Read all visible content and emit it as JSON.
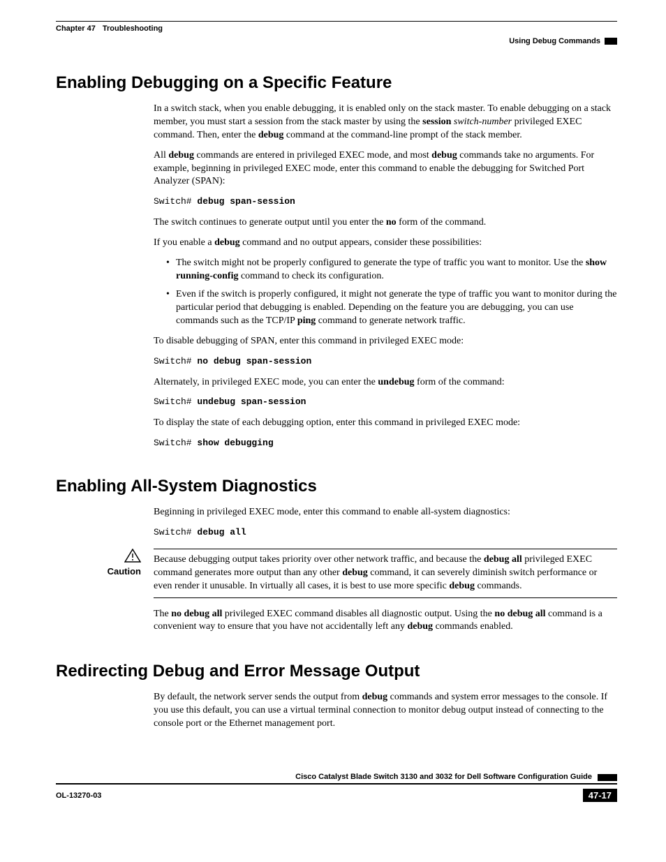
{
  "header": {
    "chapter": "Chapter 47",
    "chapter_title": "Troubleshooting",
    "section_label": "Using Debug Commands"
  },
  "s1": {
    "title": "Enabling Debugging on a Specific Feature",
    "p1a": "In a switch stack, when you enable debugging, it is enabled only on the stack master. To enable debugging on a stack member, you must start a session from the stack master by using the ",
    "p1b_bold": "session",
    "p1c_it": " switch-number",
    "p1d": " privileged EXEC command. Then, enter the ",
    "p1e_bold": "debug",
    "p1f": " command at the command-line prompt of the stack member.",
    "p2a": "All ",
    "p2b_bold": "debug",
    "p2c": " commands are entered in privileged EXEC mode, and most ",
    "p2d_bold": "debug",
    "p2e": " commands take no arguments. For example, beginning in privileged EXEC mode, enter this command to enable the debugging for Switched Port Analyzer (SPAN):",
    "code1_prompt": "Switch# ",
    "code1_cmd": "debug span-session",
    "p3a": "The switch continues to generate output until you enter the ",
    "p3b_bold": "no",
    "p3c": " form of the command.",
    "p4a": "If you enable a ",
    "p4b_bold": "debug",
    "p4c": " command and no output appears, consider these possibilities:",
    "li1a": "The switch might not be properly configured to generate the type of traffic you want to monitor. Use the ",
    "li1b_bold": "show running-config",
    "li1c": " command to check its configuration.",
    "li2a": "Even if the switch is properly configured, it might not generate the type of traffic you want to monitor during the particular period that debugging is enabled. Depending on the feature you are debugging, you can use commands such as the TCP/IP ",
    "li2b_bold": "ping",
    "li2c": " command to generate network traffic.",
    "p5": "To disable debugging of SPAN, enter this command in privileged EXEC mode:",
    "code2_prompt": "Switch# ",
    "code2_cmd": "no debug span-session",
    "p6a": "Alternately, in privileged EXEC mode, you can enter the ",
    "p6b_bold": "undebug",
    "p6c": " form of the command:",
    "code3_prompt": "Switch# ",
    "code3_cmd": "undebug span-session",
    "p7": "To display the state of each debugging option, enter this command in privileged EXEC mode:",
    "code4_prompt": "Switch# ",
    "code4_cmd": "show debugging"
  },
  "s2": {
    "title": "Enabling All-System Diagnostics",
    "p1": "Beginning in privileged EXEC mode, enter this command to enable all-system diagnostics:",
    "code1_prompt": "Switch# ",
    "code1_cmd": "debug all",
    "caution_label": "Caution",
    "c1a": "Because debugging output takes priority over other network traffic, and because the ",
    "c1b_bold": "debug all",
    "c1c": " privileged EXEC command generates more output than any other ",
    "c1d_bold": "debug",
    "c1e": " command, it can severely diminish switch performance or even render it unusable. In virtually all cases, it is best to use more specific ",
    "c1f_bold": "debug",
    "c1g": " commands.",
    "p2a": "The ",
    "p2b_bold": "no debug all",
    "p2c": " privileged EXEC command disables all diagnostic output. Using the ",
    "p2d_bold": "no debug all",
    "p2e": " command is a convenient way to ensure that you have not accidentally left any ",
    "p2f_bold": "debug",
    "p2g": " commands enabled."
  },
  "s3": {
    "title": "Redirecting Debug and Error Message Output",
    "p1a": "By default, the network server sends the output from ",
    "p1b_bold": "debug",
    "p1c": " commands and system error messages to the console. If you use this default, you can use a virtual terminal connection to monitor debug output instead of connecting to the console port or the Ethernet management port."
  },
  "footer": {
    "book_title": "Cisco Catalyst Blade Switch 3130 and 3032 for Dell Software Configuration Guide",
    "doc_id": "OL-13270-03",
    "page_no": "47-17"
  }
}
